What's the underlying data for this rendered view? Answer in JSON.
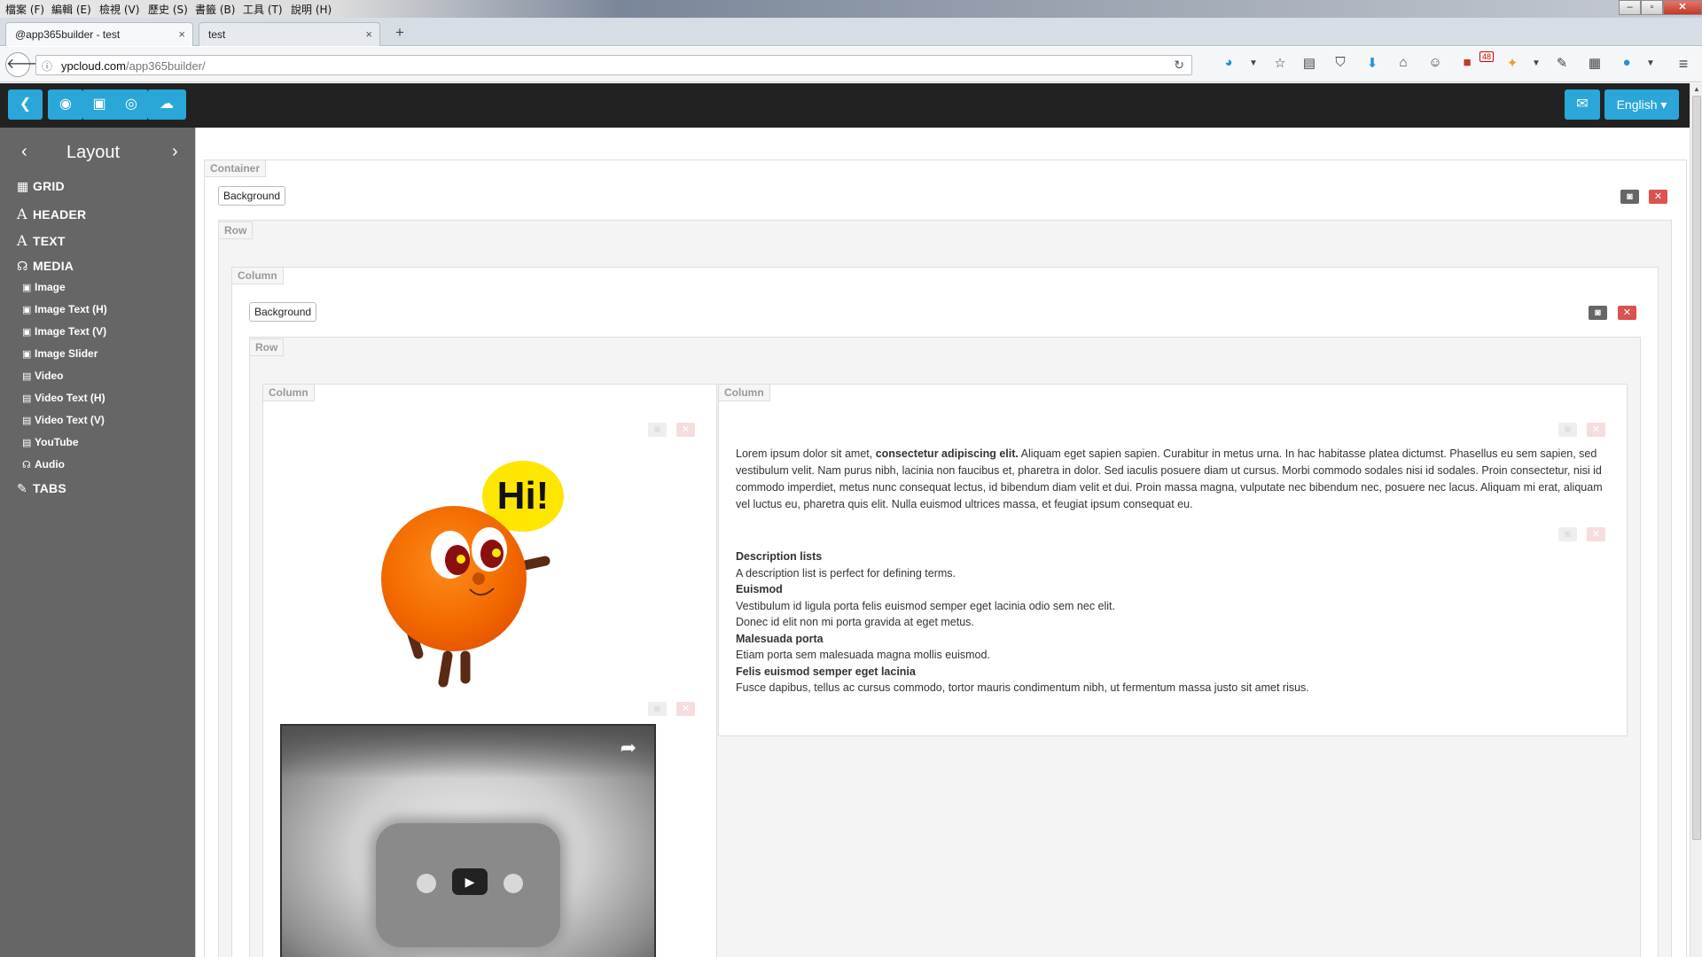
{
  "menubar": {
    "items": [
      "檔案 (F)",
      "編輯 (E)",
      "檢視 (V)",
      "歷史 (S)",
      "書籤 (B)",
      "工具 (T)",
      "說明 (H)"
    ]
  },
  "browser": {
    "tabs": [
      {
        "label": "@app365builder - test",
        "active": true
      },
      {
        "label": "test",
        "active": false
      }
    ],
    "new_tab": "+",
    "url_domain": "ypcloud.com",
    "url_path": "/app365builder/",
    "badge_count": "48",
    "toolbar_icons": [
      "sync-icon",
      "dropdown-icon",
      "star-icon",
      "reader-icon",
      "pocket-icon",
      "download-icon",
      "home-icon",
      "chat-icon",
      "addon-icon",
      "addon2-icon",
      "dropdown2-icon",
      "note-icon",
      "tabs-icon",
      "extension-icon",
      "menu-icon"
    ]
  },
  "appbar": {
    "buttons": [
      "back-icon",
      "undo-icon",
      "save-icon",
      "preview-icon",
      "publish-icon"
    ],
    "language": "English ▾",
    "mail_icon": "mail-icon"
  },
  "sidebar": {
    "title": "Layout",
    "prev": "‹",
    "next": "›",
    "sections": [
      {
        "icon": "grid-icon",
        "label": "GRID"
      },
      {
        "icon": "font-icon",
        "label": "HEADER"
      },
      {
        "icon": "font-icon",
        "label": "TEXT"
      },
      {
        "icon": "headphones-icon",
        "label": "MEDIA"
      }
    ],
    "media_items": [
      {
        "icon": "picture-icon",
        "label": "Image"
      },
      {
        "icon": "picture-icon",
        "label": "Image Text (H)"
      },
      {
        "icon": "picture-icon",
        "label": "Image Text (V)"
      },
      {
        "icon": "picture-icon",
        "label": "Image Slider"
      },
      {
        "icon": "film-icon",
        "label": "Video"
      },
      {
        "icon": "film-icon",
        "label": "Video Text (H)"
      },
      {
        "icon": "film-icon",
        "label": "Video Text (V)"
      },
      {
        "icon": "film-icon",
        "label": "YouTube"
      },
      {
        "icon": "headphones-icon",
        "label": "Audio"
      }
    ],
    "tabs_section": {
      "icon": "pencil-icon",
      "label": "TABS"
    }
  },
  "canvas": {
    "container_label": "Container",
    "row_label": "Row",
    "column_label": "Column",
    "background_label": "Background",
    "image_text": "Hi!",
    "lorem": {
      "part1": "Lorem ipsum dolor sit amet, ",
      "bold": "consectetur adipiscing elit.",
      "part2": " Aliquam eget sapien sapien. Curabitur in metus urna. In hac habitasse platea dictumst. Phasellus eu sem sapien, sed vestibulum velit. Nam purus nibh, lacinia non faucibus et, pharetra in dolor. Sed iaculis posuere diam ut cursus. Morbi commodo sodales nisi id sodales. Proin consectetur, nisi id commodo imperdiet, metus nunc consequat lectus, id bibendum diam velit et dui. Proin massa magna, vulputate nec bibendum nec, posuere nec lacus. Aliquam mi erat, aliquam vel luctus eu, pharetra quis elit. Nulla euismod ultrices massa, et feugiat ipsum consequat eu."
    },
    "deflist": [
      {
        "term": "Description lists",
        "desc": [
          "A description list is perfect for defining terms."
        ]
      },
      {
        "term": "Euismod",
        "desc": [
          "Vestibulum id ligula porta felis euismod semper eget lacinia odio sem nec elit.",
          "Donec id elit non mi porta gravida at eget metus."
        ]
      },
      {
        "term": "Malesuada porta",
        "desc": [
          "Etiam porta sem malesuada magna mollis euismod."
        ]
      },
      {
        "term": "Felis euismod semper eget lacinia",
        "desc": [
          "Fusce dapibus, tellus ac cursus commodo, tortor mauris condimentum nibh, ut fermentum massa justo sit amet risus."
        ]
      }
    ]
  },
  "colors": {
    "accent": "#2aa7d8",
    "appbar": "#222222",
    "sidebar": "#666666",
    "danger": "#d9534f"
  }
}
